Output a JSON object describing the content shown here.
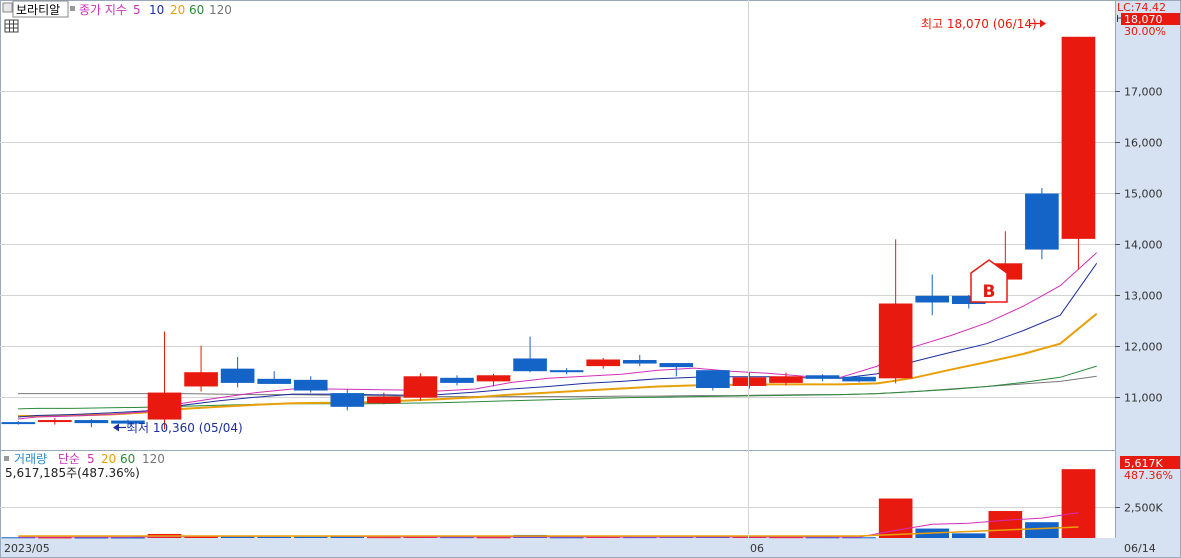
{
  "header": {
    "stock_name": "보라티알",
    "price_title": "종가 지수",
    "ma_periods": [
      "5",
      "10",
      "20",
      "60",
      "120"
    ]
  },
  "volume_header": {
    "title": "거래량",
    "type": "단순",
    "ma_periods": [
      "5",
      "20",
      "60",
      "120"
    ],
    "info": "5,617,185주(487.36%)"
  },
  "right_labels": {
    "lc": "LC:74.42",
    "h_marker": "H",
    "last_price": "18,070",
    "last_change": "30.00%",
    "last_volume": "5,617K",
    "last_volume_pct": "487.36%"
  },
  "annotations": {
    "high_label": "최고 18,070 (06/14)",
    "low_label": "최저 10,360 (05/04)",
    "buy_marker": "B"
  },
  "x_axis": {
    "start_label": "2023/05",
    "mid_label": "06",
    "end_label": "06/14"
  },
  "colors": {
    "up": "#e8190e",
    "down": "#1464c8",
    "ma5": "#d22fb9",
    "ma10": "#1c2ea0",
    "ma20": "#e8a00a",
    "ma60": "#2a8a3c",
    "ma120": "#777777",
    "grid": "#d4d4d4",
    "panel_bg": "#d6e2f1",
    "axis_text": "#333333"
  },
  "chart_data": [
    {
      "type": "candlestick",
      "title": "",
      "y_ticks": [
        11000,
        12000,
        13000,
        14000,
        15000,
        16000,
        17000
      ],
      "ylim": [
        10050,
        18400
      ],
      "grid": true,
      "candles": [
        {
          "o": 10500,
          "h": 10520,
          "l": 10450,
          "c": 10480
        },
        {
          "o": 10520,
          "h": 10580,
          "l": 10450,
          "c": 10540
        },
        {
          "o": 10540,
          "h": 10560,
          "l": 10400,
          "c": 10480
        },
        {
          "o": 10530,
          "h": 10550,
          "l": 10380,
          "c": 10470
        },
        {
          "o": 10550,
          "h": 12280,
          "l": 10360,
          "c": 11080
        },
        {
          "o": 11200,
          "h": 12000,
          "l": 11100,
          "c": 11480
        },
        {
          "o": 11550,
          "h": 11780,
          "l": 11180,
          "c": 11270
        },
        {
          "o": 11350,
          "h": 11500,
          "l": 11250,
          "c": 11250
        },
        {
          "o": 11330,
          "h": 11400,
          "l": 11080,
          "c": 11120
        },
        {
          "o": 11070,
          "h": 11150,
          "l": 10730,
          "c": 10800
        },
        {
          "o": 10870,
          "h": 11080,
          "l": 10850,
          "c": 11000
        },
        {
          "o": 10980,
          "h": 11460,
          "l": 10920,
          "c": 11400
        },
        {
          "o": 11370,
          "h": 11420,
          "l": 11220,
          "c": 11270
        },
        {
          "o": 11300,
          "h": 11450,
          "l": 11200,
          "c": 11420
        },
        {
          "o": 11750,
          "h": 12180,
          "l": 11480,
          "c": 11500
        },
        {
          "o": 11520,
          "h": 11560,
          "l": 11440,
          "c": 11480
        },
        {
          "o": 11600,
          "h": 11760,
          "l": 11550,
          "c": 11730
        },
        {
          "o": 11720,
          "h": 11820,
          "l": 11600,
          "c": 11650
        },
        {
          "o": 11660,
          "h": 11660,
          "l": 11400,
          "c": 11580
        },
        {
          "o": 11520,
          "h": 11520,
          "l": 11120,
          "c": 11170
        },
        {
          "o": 11210,
          "h": 11480,
          "l": 11160,
          "c": 11380
        },
        {
          "o": 11270,
          "h": 11470,
          "l": 11220,
          "c": 11400
        },
        {
          "o": 11420,
          "h": 11440,
          "l": 11300,
          "c": 11350
        },
        {
          "o": 11390,
          "h": 11420,
          "l": 11280,
          "c": 11300
        },
        {
          "o": 11360,
          "h": 14090,
          "l": 11260,
          "c": 12830
        },
        {
          "o": 12980,
          "h": 13400,
          "l": 12600,
          "c": 12850
        },
        {
          "o": 12980,
          "h": 13000,
          "l": 12730,
          "c": 12820
        },
        {
          "o": 13300,
          "h": 14250,
          "l": 13150,
          "c": 13620
        },
        {
          "o": 14990,
          "h": 15100,
          "l": 13700,
          "c": 13890
        },
        {
          "o": 14100,
          "h": 18070,
          "l": 13500,
          "c": 18070
        }
      ],
      "ma": {
        "ma5": [
          10560,
          10600,
          10620,
          10650,
          10700,
          10870,
          10980,
          11080,
          11150,
          11150,
          11140,
          11130,
          11110,
          11150,
          11280,
          11360,
          11400,
          11440,
          11520,
          11560,
          11500,
          11460,
          11400,
          11380,
          11600,
          11980,
          12200,
          12450,
          12780,
          13180,
          13830
        ],
        "ma10": [
          10600,
          10630,
          10650,
          10680,
          10720,
          10830,
          10920,
          10990,
          11050,
          11050,
          11040,
          11030,
          11040,
          11090,
          11150,
          11200,
          11260,
          11300,
          11350,
          11380,
          11390,
          11390,
          11370,
          11360,
          11450,
          11690,
          11870,
          12040,
          12300,
          12600,
          13620
        ],
        "ma20": [
          10620,
          10620,
          10630,
          10650,
          10690,
          10760,
          10800,
          10840,
          10870,
          10880,
          10890,
          10920,
          10950,
          10990,
          11040,
          11080,
          11120,
          11160,
          11200,
          11220,
          11230,
          11240,
          11240,
          11240,
          11260,
          11370,
          11530,
          11680,
          11840,
          12040,
          12630
        ],
        "ma60": [
          10760,
          10770,
          10770,
          10780,
          10790,
          10810,
          10830,
          10850,
          10860,
          10860,
          10860,
          10870,
          10880,
          10900,
          10920,
          10940,
          10960,
          10980,
          10990,
          11000,
          11010,
          11020,
          11030,
          11040,
          11060,
          11100,
          11140,
          11200,
          11280,
          11380,
          11600
        ],
        "ma120": [
          11060,
          11060,
          11060,
          11060,
          11060,
          11060,
          11050,
          11040,
          11040,
          11030,
          11020,
          11010,
          11000,
          11000,
          11000,
          11000,
          11000,
          11010,
          11010,
          11020,
          11020,
          11030,
          11040,
          11040,
          11060,
          11100,
          11150,
          11200,
          11250,
          11300,
          11400
        ]
      }
    },
    {
      "type": "bar",
      "title": "",
      "y_ticks": [
        2500000
      ],
      "y_tick_labels": [
        "2,500K"
      ],
      "ylim": [
        0,
        6200000
      ],
      "volumes": [
        60000,
        50000,
        40000,
        40000,
        330000,
        160000,
        110000,
        90000,
        100000,
        120000,
        70000,
        130000,
        70000,
        60000,
        250000,
        60000,
        80000,
        70000,
        80000,
        140000,
        90000,
        70000,
        60000,
        60000,
        3220000,
        770000,
        380000,
        2200000,
        1290000,
        5617185
      ],
      "vol_ma5": [
        70000,
        70000,
        70000,
        70000,
        110000,
        130000,
        140000,
        150000,
        160000,
        130000,
        100000,
        90000,
        85000,
        80000,
        90000,
        80000,
        80000,
        70000,
        70000,
        80000,
        80000,
        80000,
        80000,
        70000,
        620000,
        1120000,
        1200000,
        1450000,
        1620000,
        2070000
      ]
    }
  ]
}
